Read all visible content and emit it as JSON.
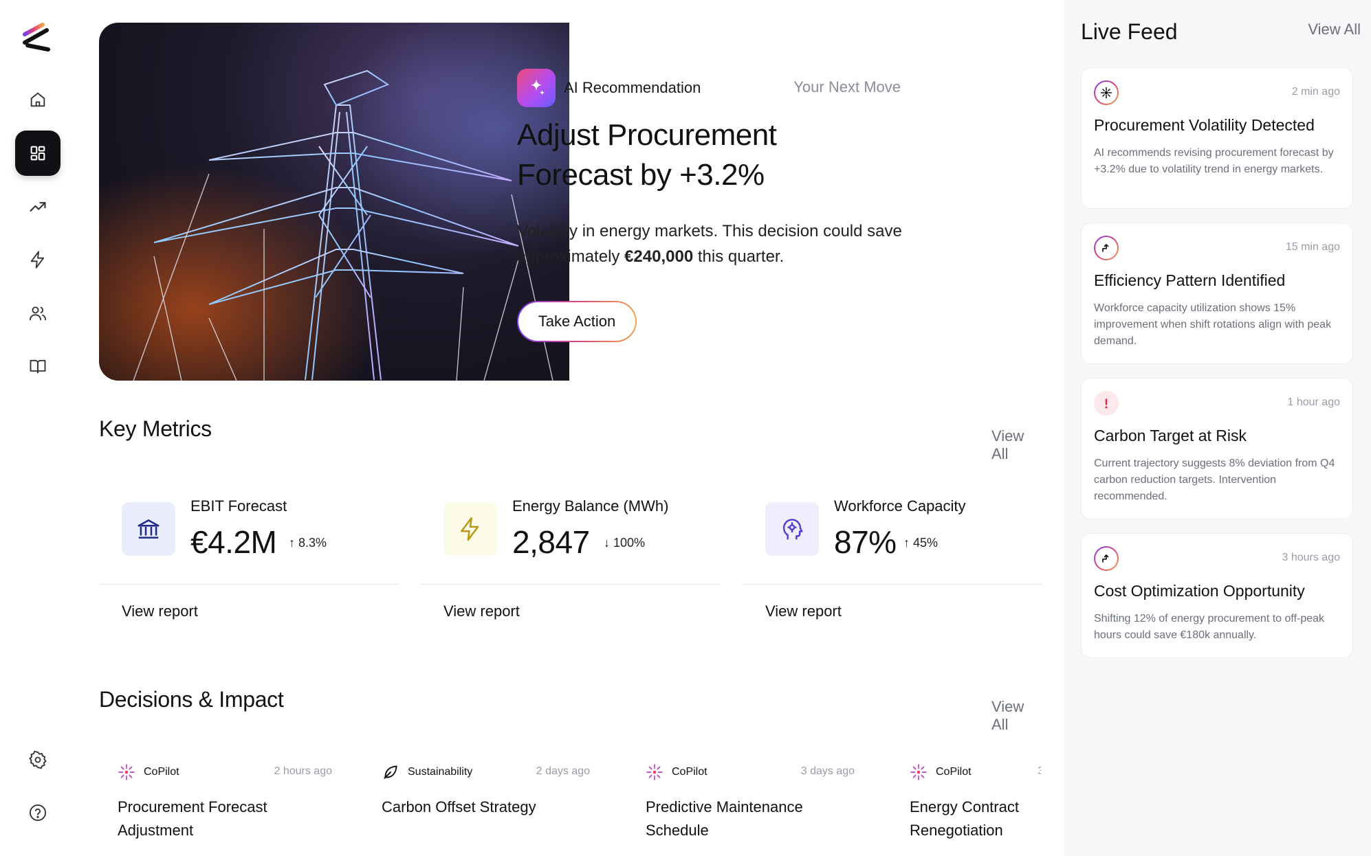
{
  "sidebar": {
    "items": [
      {
        "name": "home",
        "icon": "home-icon"
      },
      {
        "name": "dashboard",
        "icon": "dashboard-grid-icon",
        "active": true
      },
      {
        "name": "trends",
        "icon": "trending-up-icon"
      },
      {
        "name": "energy",
        "icon": "lightning-icon"
      },
      {
        "name": "team",
        "icon": "users-icon"
      },
      {
        "name": "library",
        "icon": "book-icon"
      },
      {
        "name": "settings",
        "icon": "gear-icon"
      },
      {
        "name": "help",
        "icon": "help-circle-icon"
      }
    ]
  },
  "recommendation": {
    "label": "AI Recommendation",
    "next": "Your Next Move",
    "title_line1": "Adjust Procurement",
    "title_line2": "Forecast by +3.2%",
    "desc_prefix": "Volatility in energy markets. This decision could save approximately ",
    "desc_amount": "€240,000",
    "desc_suffix": " this quarter.",
    "action": "Take Action"
  },
  "key_metrics": {
    "title": "Key Metrics",
    "view_all": "View All",
    "items": [
      {
        "label": "EBIT Forecast",
        "value": "€4.2M",
        "delta": "8.3%",
        "direction": "up",
        "link": "View report",
        "icon": "bank-icon",
        "icon_bg": "#eaeefc",
        "icon_color": "#1f2a8a"
      },
      {
        "label": "Energy Balance (MWh)",
        "value": "2,847",
        "delta": "100%",
        "direction": "down",
        "link": "View report",
        "icon": "lightning-icon",
        "icon_bg": "#fbfbe8",
        "icon_color": "#b79a14"
      },
      {
        "label": "Workforce Capacity",
        "value": "87%",
        "delta": "45%",
        "direction": "up",
        "link": "View report",
        "icon": "brain-head-icon",
        "icon_bg": "#efeefc",
        "icon_color": "#5b3fd0"
      }
    ]
  },
  "decisions": {
    "title": "Decisions & Impact",
    "view_all": "View All",
    "items": [
      {
        "category": "CoPilot",
        "time": "2 hours ago",
        "title": "Procurement Forecast Adjustment"
      },
      {
        "category": "Sustainability",
        "time": "2 days ago",
        "title": "Carbon Offset Strategy"
      },
      {
        "category": "CoPilot",
        "time": "3 days ago",
        "title": "Predictive Maintenance Schedule"
      },
      {
        "category": "CoPilot",
        "time": "3",
        "title": "Energy Contract Renegotiation"
      }
    ]
  },
  "live_feed": {
    "title": "Live Feed",
    "view_all": "View All",
    "items": [
      {
        "time": "2 min ago",
        "title": "Procurement Volatility Detected",
        "desc": "AI recommends revising procurement forecast by +3.2% due to volatility trend in energy markets.",
        "icon": "sparkle-icon"
      },
      {
        "time": "15 min ago",
        "title": "Efficiency Pattern Identified",
        "desc": "Workforce capacity utilization shows 15% improvement when shift rotations align with peak demand.",
        "icon": "growth-arrow-icon"
      },
      {
        "time": "1 hour ago",
        "title": "Carbon Target at Risk",
        "desc": "Current trajectory suggests 8% deviation from Q4 carbon reduction targets. Intervention recommended.",
        "icon": "alert-icon"
      },
      {
        "time": "3 hours ago",
        "title": "Cost Optimization Opportunity",
        "desc": "Shifting 12% of energy procurement to off-peak hours could save €180k annually.",
        "icon": "growth-arrow-icon"
      }
    ]
  },
  "colors": {
    "accent_gradient_start": "#7a3cf0",
    "accent_gradient_mid": "#e0427a",
    "accent_gradient_end": "#f2a34a",
    "alert": "#e02040"
  }
}
